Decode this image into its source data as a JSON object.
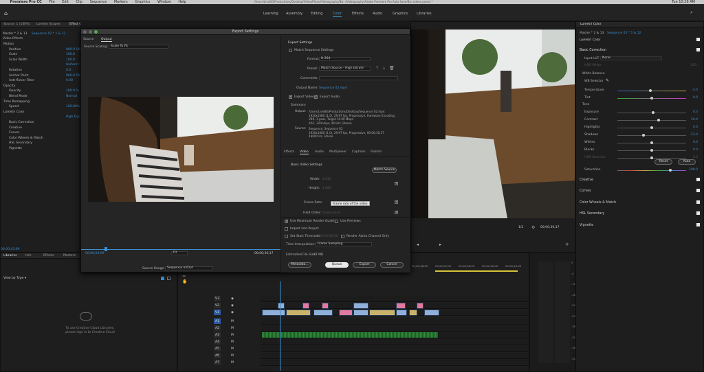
{
  "menubar": {
    "apple": "",
    "app": "Premiere Pro CC",
    "items": [
      "File",
      "Edit",
      "Clip",
      "Sequence",
      "Markers",
      "Graphics",
      "Window",
      "Help"
    ],
    "path": "/Users/LiveBG/Productions/Desktop/Video/Photo/Videography/Biz -/Videography/Adobe Premiere Pro Auto Save/Biz videos.prproj *",
    "clock": "Tue 10:28 AM"
  },
  "workspaces": [
    {
      "label": "Learning",
      "active": false
    },
    {
      "label": "Assembly",
      "active": false
    },
    {
      "label": "Editing",
      "active": false
    },
    {
      "label": "Color",
      "active": true
    },
    {
      "label": "Effects",
      "active": false
    },
    {
      "label": "Audio",
      "active": false
    },
    {
      "label": "Graphics",
      "active": false
    },
    {
      "label": "Libraries",
      "active": false
    }
  ],
  "source_panel": {
    "tabs": [
      "Source: 1 (100%)",
      "Lumetri Scopes",
      "Effect Controls",
      "Audio Clip Mixer: Sequence 02"
    ],
    "master": "Master * 2 & 13",
    "sequence": "Sequence 02 * 1 & 12",
    "section": "Video Effects",
    "rows": [
      {
        "name": "Motion",
        "value": "",
        "fx": true
      },
      {
        "name": "Position",
        "value": "960.0   540.0"
      },
      {
        "name": "Scale",
        "value": "100.0"
      },
      {
        "name": "Scale Width",
        "value": "100.0"
      },
      {
        "name": "",
        "value": "Uniform Scale"
      },
      {
        "name": "Rotation",
        "value": "0.0"
      },
      {
        "name": "Anchor Point",
        "value": "960.0   540.0"
      },
      {
        "name": "Anti-flicker Filter",
        "value": "0.00"
      },
      {
        "name": "Opacity",
        "value": "",
        "fx": true
      },
      {
        "name": "Opacity",
        "value": "100.0 %"
      },
      {
        "name": "Blend Mode",
        "value": "Normal"
      },
      {
        "name": "Time Remapping",
        "value": "",
        "fx": true
      },
      {
        "name": "Speed",
        "value": "100.00%"
      },
      {
        "name": "Lumetri Color",
        "value": "",
        "fx": true
      },
      {
        "name": "",
        "value": "High Dynamic Range"
      },
      {
        "name": "Basic Correction",
        "value": ""
      },
      {
        "name": "Creative",
        "value": ""
      },
      {
        "name": "Curves",
        "value": ""
      },
      {
        "name": "Color Wheels & Match",
        "value": ""
      },
      {
        "name": "HSL Secondary",
        "value": ""
      },
      {
        "name": "Vignette",
        "value": ""
      }
    ],
    "timecode": "00;00;03;09"
  },
  "library_panel": {
    "tabs": [
      "Libraries",
      "Info",
      "Effects",
      "Markers"
    ],
    "view_by": "View by Type",
    "message_line1": "To use Creative Cloud Libraries,",
    "message_line2": "please sign in to Creative Cloud"
  },
  "program_panel": {
    "title": "Program: Sequence 02",
    "fraction": "1/2",
    "timecode": "00;00;30;17"
  },
  "export": {
    "title": "Export Settings",
    "tabs": [
      "Source",
      "Output"
    ],
    "source_scaling_label": "Source Scaling:",
    "source_scaling_value": "Scale To Fit",
    "preview_start": "00;00;03;09",
    "preview_end": "00;00;30;17",
    "fit_label": "Fit",
    "source_range_label": "Source Range:",
    "source_range_value": "Sequence In/Out",
    "settings_header": "Export Settings",
    "match_seq": "Match Sequence Settings",
    "format_label": "Format:",
    "format_value": "H.264",
    "preset_label": "Preset:",
    "preset_value": "Match Source - High bitrate",
    "comments_label": "Comments:",
    "output_name_label": "Output Name:",
    "output_name_value": "Sequence 02.mp4",
    "export_video": "Export Video",
    "export_audio": "Export Audio",
    "summary_header": "Summary",
    "output_label": "Output:",
    "output_lines": [
      "/Users/LiveBG/Productions/Desktop/Sequence 02.mp4",
      "1920x1080 (1.0), 29.97 fps, Progressive, Hardware Encoding,",
      "VBR, 1 pass, Target 10.00 Mbps",
      "AAC, 320 kbps, 48 kHz, Stereo"
    ],
    "source_label": "Source:",
    "source_lines": [
      "Sequence, Sequence 02",
      "1920x1080 (1.0), 29.97 fps, Progressive, 00;00;30;17",
      "48000 Hz, Stereo"
    ],
    "settings_tabs": [
      "Effects",
      "Video",
      "Audio",
      "Multiplexer",
      "Captions",
      "Publish"
    ],
    "basic_video": "Basic Video Settings",
    "match_source_btn": "Match Source",
    "width_label": "Width:",
    "width_value": "1,920",
    "height_label": "Height:",
    "height_value": "1,080",
    "frame_rate_label": "Frame Rate:",
    "tooltip": "Frame rate of the video",
    "field_order_label": "Field Order:",
    "field_order_value": "Progressive",
    "max_render": "Use Maximum Render Quality",
    "use_previews": "Use Previews",
    "import_project": "Import into Project",
    "set_start_tc": "Set Start Timecode",
    "start_tc_value": "00;00;00;00",
    "render_alpha": "Render Alpha Channel Only",
    "time_interp_label": "Time Interpolation:",
    "time_interp_value": "Frame Sampling",
    "file_size_label": "Estimated File Size:",
    "file_size_value": "37 MB",
    "metadata_btn": "Metadata...",
    "queue_btn": "Queue",
    "export_btn": "Export",
    "cancel_btn": "Cancel"
  },
  "lumetri": {
    "title": "Lumetri Color",
    "master": "Master * 2 & 13",
    "sequence": "Sequence 02 * 1 & 12",
    "clip": "Lumetri Color",
    "basic_correction": "Basic Correction",
    "input_lut_label": "Input LUT",
    "input_lut_value": "None",
    "hdr_white": "HDR White",
    "hdr_white_value": "100",
    "white_balance": "White Balance",
    "wb_selector": "WB Selector",
    "tone": "Tone",
    "sliders": [
      {
        "label": "Temperature",
        "value": "-3.0",
        "pos": 0.48
      },
      {
        "label": "Tint",
        "value": "0.0",
        "pos": 0.5
      },
      {
        "label": "Exposure",
        "value": "0.3",
        "pos": 0.52
      },
      {
        "label": "Contrast",
        "value": "20.0",
        "pos": 0.6
      },
      {
        "label": "Highlights",
        "value": "0.0",
        "pos": 0.5
      },
      {
        "label": "Shadows",
        "value": "-23.0",
        "pos": 0.38
      },
      {
        "label": "Whites",
        "value": "0.0",
        "pos": 0.5
      },
      {
        "label": "Blacks",
        "value": "0.0",
        "pos": 0.5
      },
      {
        "label": "HDR Specular",
        "value": "0.0",
        "pos": 0.5
      }
    ],
    "reset_btn": "Reset",
    "auto_btn": "Auto",
    "saturation_label": "Saturation",
    "saturation_value": "100.0",
    "sections": [
      "Creative",
      "Curves",
      "Color Wheels & Match",
      "HSL Secondary",
      "Vignette"
    ]
  },
  "timeline": {
    "ruler": [
      "00;00;28;00",
      "00;00;32;00",
      "00;00;36;00",
      "00;00;40;00",
      "00;00;44;00"
    ],
    "tracks": [
      "V3",
      "V2",
      "V1",
      "A1",
      "A2",
      "A3",
      "A4",
      "A5",
      "A6",
      "A7"
    ],
    "vu_labels": [
      "0",
      "-6",
      "-12",
      "-18",
      "-24",
      "-30",
      "-36",
      "-42",
      "-48",
      "-54"
    ]
  }
}
